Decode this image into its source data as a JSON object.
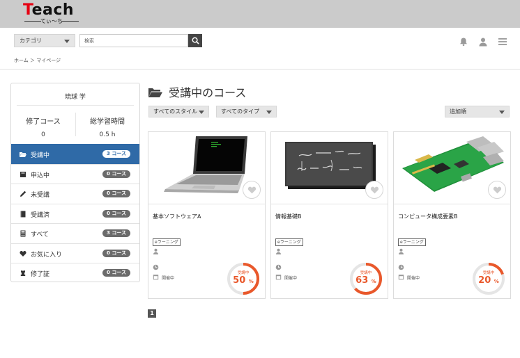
{
  "header": {
    "logo_main": "Teach",
    "logo_sub": "てぃ〜ち",
    "category_label": "カテゴリ",
    "search_placeholder": "検索"
  },
  "breadcrumb": "ホーム ＞ マイページ",
  "sidebar": {
    "user_name": "琉球 学",
    "stats": {
      "completed_label": "修了コース",
      "completed_value": "0",
      "hours_label": "総学習時間",
      "hours_value": "0.5 h"
    },
    "items": [
      {
        "label": "受講中",
        "badge": "3 コース",
        "icon": "folder-open-icon"
      },
      {
        "label": "申込中",
        "badge": "0 コース",
        "icon": "book-icon"
      },
      {
        "label": "未受講",
        "badge": "0 コース",
        "icon": "pencil-icon"
      },
      {
        "label": "受講済",
        "badge": "0 コース",
        "icon": "book-closed-icon"
      },
      {
        "label": "すべて",
        "badge": "3 コース",
        "icon": "calculator-icon"
      },
      {
        "label": "お気に入り",
        "badge": "0 コース",
        "icon": "heart-icon"
      },
      {
        "label": "修了証",
        "badge": "0 コース",
        "icon": "chess-icon"
      }
    ]
  },
  "main": {
    "title": "受講中のコース",
    "filters": {
      "style": "すべてのスタイル",
      "type": "すべてのタイプ",
      "sort": "追加順"
    },
    "courses": [
      {
        "title": "基本ソフトウェアA",
        "tag": "eラーニング",
        "status": "開催中",
        "progress_label": "受講中",
        "progress": 50,
        "pct_sign": "%"
      },
      {
        "title": "情報基礎B",
        "tag": "eラーニング",
        "status": "開催中",
        "progress_label": "受講中",
        "progress": 63,
        "pct_sign": "%"
      },
      {
        "title": "コンピュータ構成要素B",
        "tag": "eラーニング",
        "status": "開催中",
        "progress_label": "受講中",
        "progress": 20,
        "pct_sign": "%"
      }
    ],
    "page": "1"
  },
  "colors": {
    "accent": "#2f6aa7",
    "progress": "#e9582b",
    "header_bg": "#cbcbcb"
  }
}
